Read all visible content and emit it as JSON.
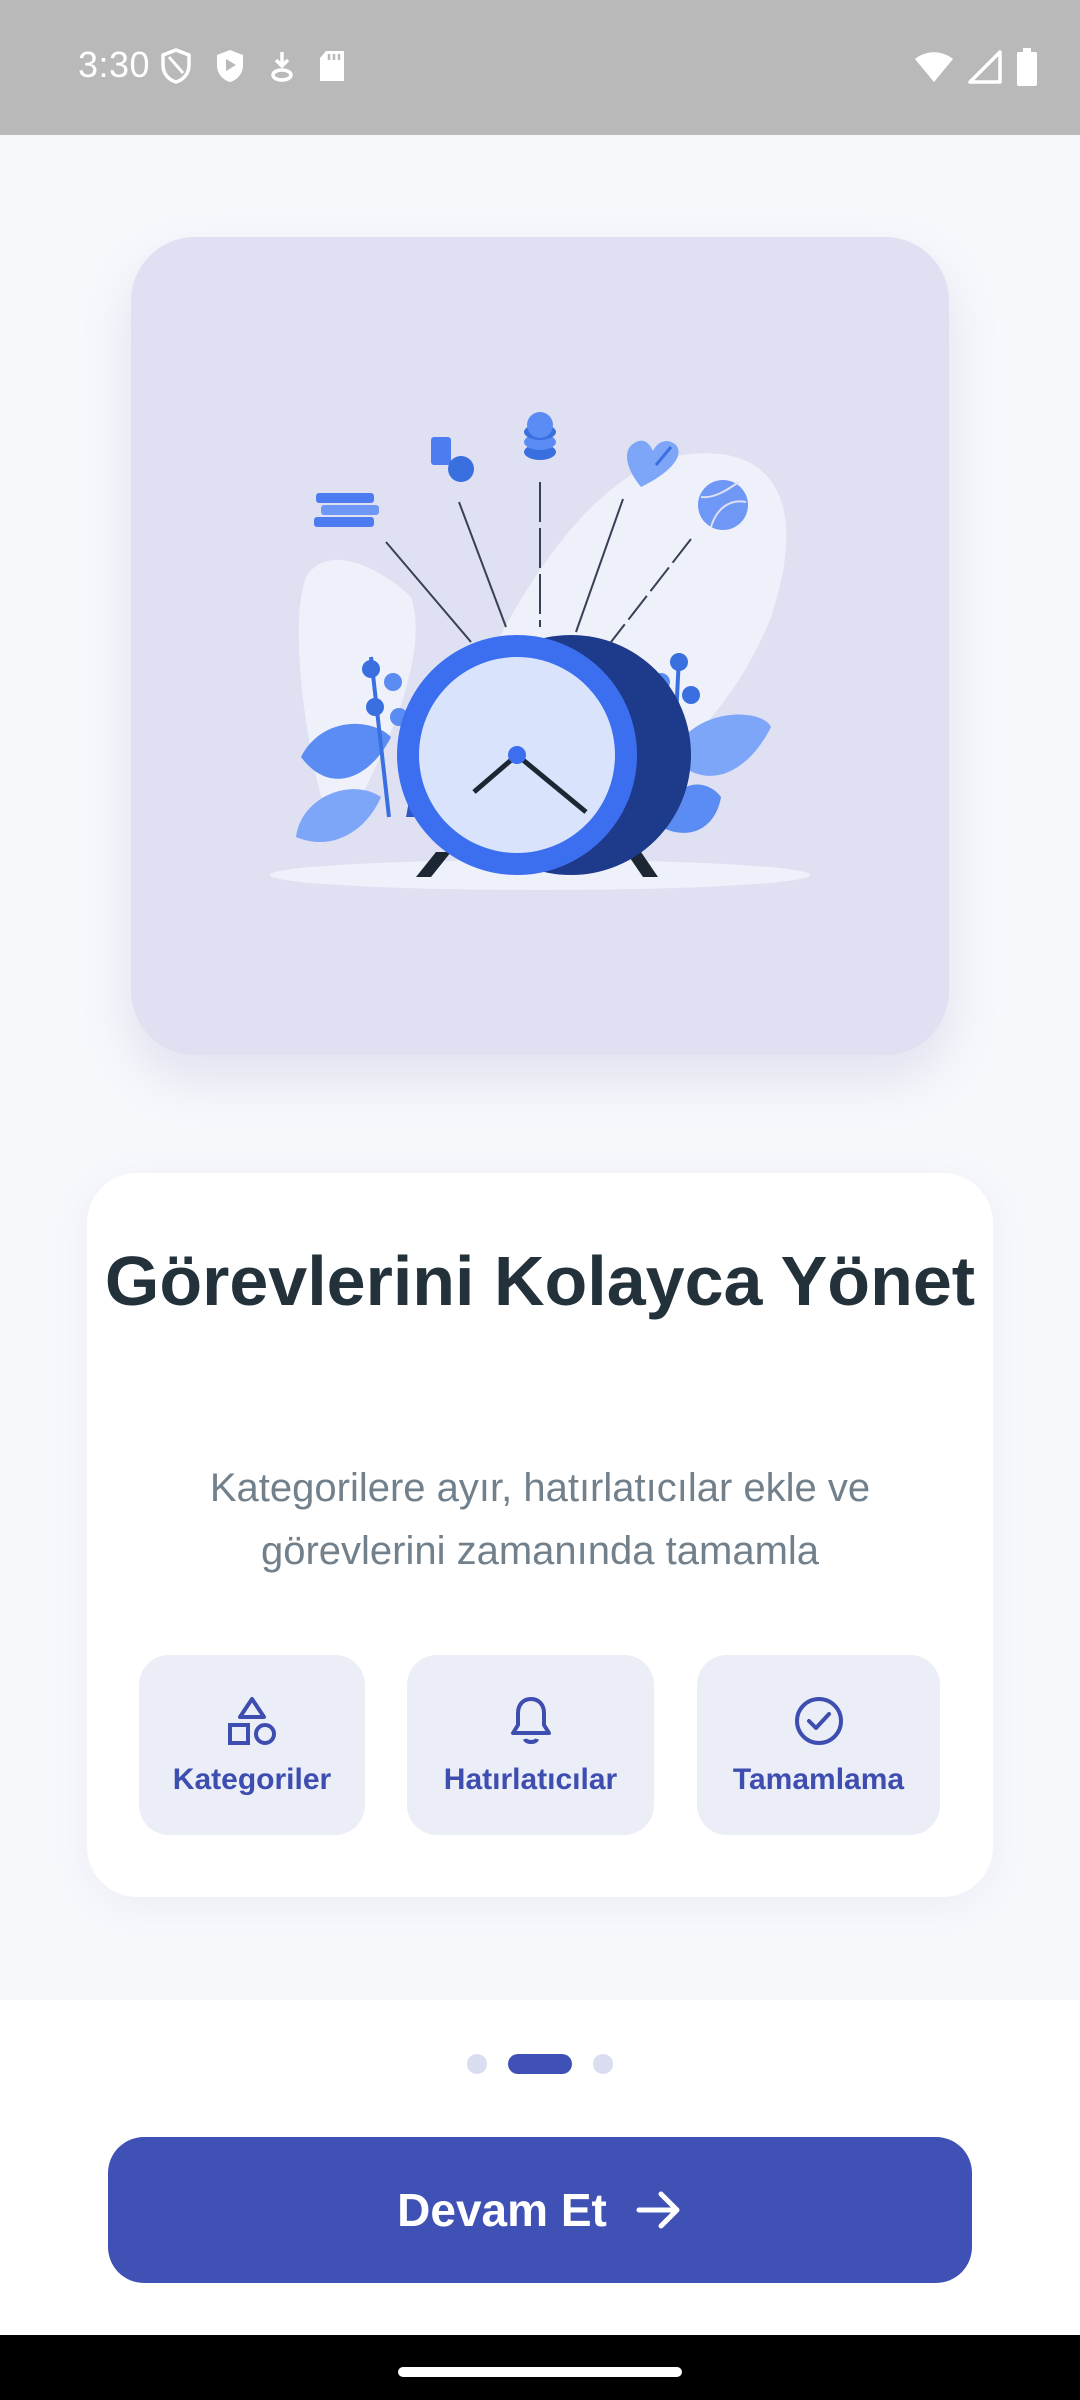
{
  "status_bar": {
    "time": "3:30",
    "left_icons": [
      "shield-outline-icon",
      "shield-play-icon",
      "download-icon",
      "sd-card-icon"
    ],
    "right_icons": [
      "wifi-icon",
      "signal-icon",
      "battery-icon"
    ]
  },
  "onboarding": {
    "title": "Görevlerini Kolayca Yönet",
    "subtitle": "Kategorilere ayır, hatırlatıcılar ekle ve görevlerini zamanında tamamla",
    "features": [
      {
        "label": "Kategoriler",
        "icon": "shapes-icon"
      },
      {
        "label": "Hatırlatıcılar",
        "icon": "bell-icon"
      },
      {
        "label": "Tamamlama",
        "icon": "check-circle-icon"
      }
    ],
    "page_indicator": {
      "total": 3,
      "active_index": 1
    },
    "cta_label": "Devam Et",
    "cta_icon": "arrow-right-icon"
  },
  "colors": {
    "primary": "#3f51b5",
    "title": "#22313a",
    "subtitle": "#71808b",
    "hero_bg": "#dfe1f2",
    "feature_bg": "#ebedf7"
  }
}
